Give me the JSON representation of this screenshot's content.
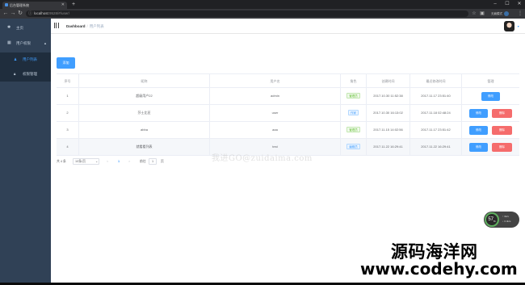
{
  "browser": {
    "tab_title": "后台管理系统",
    "url_host": "localhost",
    "url_path": ":9528/#/user/",
    "profile_label": "无痕模式"
  },
  "sidebar": {
    "items": [
      {
        "icon": "home-icon",
        "label": "主页"
      },
      {
        "icon": "grid-icon",
        "label": "用户权限",
        "expanded": true
      }
    ],
    "subitems": [
      {
        "icon": "user-icon",
        "label": "用户列表",
        "active": true
      },
      {
        "icon": "lock-icon",
        "label": "权限管理",
        "active": false
      }
    ]
  },
  "navbar": {
    "breadcrumb_root": "Dashboard",
    "breadcrumb_sep": "/",
    "breadcrumb_current": "用户列表"
  },
  "toolbar": {
    "add_label": "添加"
  },
  "table": {
    "headers": [
      "序号",
      "昵称",
      "用户名",
      "角色",
      "创建时间",
      "最近修改时间",
      "管理"
    ],
    "rows": [
      {
        "index": "1",
        "nickname": "超级用户22",
        "username": "admin",
        "role": "管理员",
        "role_color": "green",
        "created": "2017.10.30 11:52:38",
        "updated": "2017.11.17 23:51:40",
        "actions": [
          "修改"
        ]
      },
      {
        "index": "2",
        "nickname": "莎士比亚",
        "username": "user",
        "role": "作家",
        "role_color": "blue",
        "created": "2017.10.30 16:13:02",
        "updated": "2017.11.18 02:48:24",
        "actions": [
          "修改",
          "删除"
        ]
      },
      {
        "index": "3",
        "nickname": "abba",
        "username": "aaa",
        "role": "管理员",
        "role_color": "green",
        "created": "2017.11.15 14:02:56",
        "updated": "2017.11.17 23:51:42",
        "actions": [
          "修改",
          "删除"
        ]
      },
      {
        "index": "4",
        "nickname": "就看看列表",
        "username": "test",
        "role": "编辑员",
        "role_color": "blue",
        "created": "2017.11.22 16:29:41",
        "updated": "2017.11.22 16:29:41",
        "actions": [
          "修改",
          "删除"
        ]
      }
    ]
  },
  "pagination": {
    "total": "共 4 条",
    "page_size": "10条/页",
    "prev": "<",
    "current_page": "1",
    "next": ">",
    "goto_label": "前往",
    "goto_value": "1",
    "goto_suffix": "页"
  },
  "watermark_center": "我进GO@zuidaima.com",
  "speed_widget": {
    "value": "57",
    "unit": "%",
    "up": "0k/s",
    "down": "0.4k/s"
  },
  "watermark": {
    "line1": "源码海洋网",
    "line2": "www.codehy.com"
  }
}
